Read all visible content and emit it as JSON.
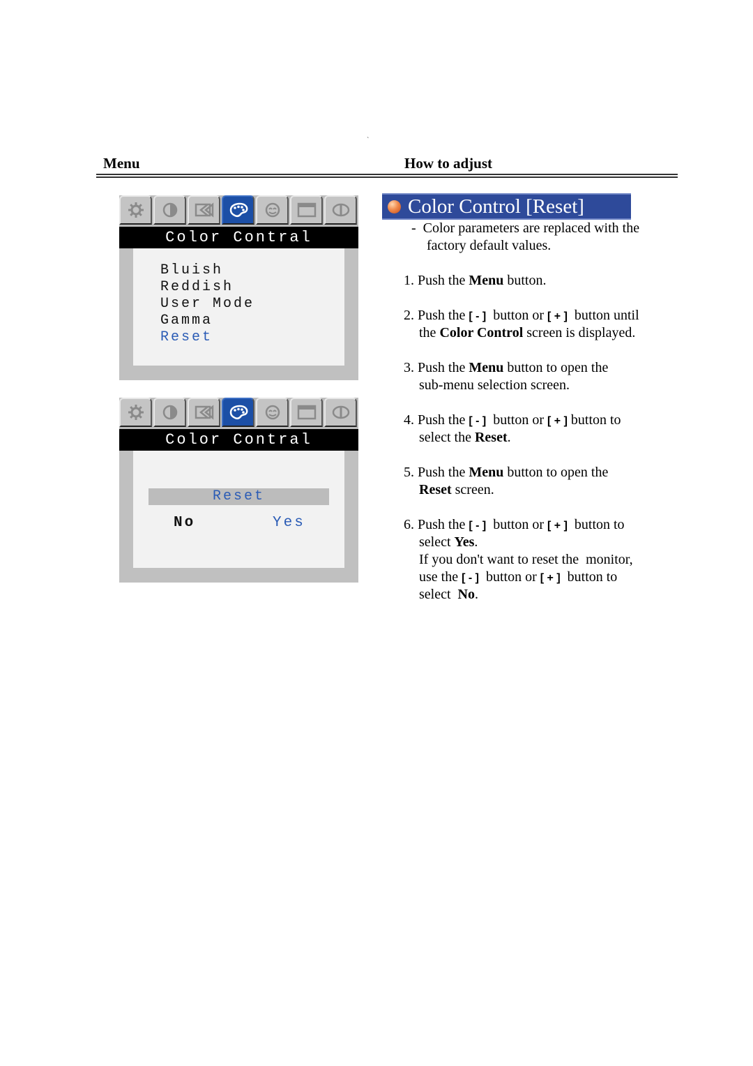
{
  "headers": {
    "menu": "Menu",
    "how_to_adjust": "How to adjust",
    "stray_mark": "`"
  },
  "osd": {
    "tabs": [
      {
        "icon": "gear-icon",
        "active": false
      },
      {
        "icon": "contrast-icon",
        "active": false
      },
      {
        "icon": "position-icon",
        "active": false
      },
      {
        "icon": "palette-icon",
        "active": true
      },
      {
        "icon": "face-icon",
        "active": false
      },
      {
        "icon": "window-icon",
        "active": false
      },
      {
        "icon": "info-icon",
        "active": false
      }
    ],
    "panel1": {
      "title": "Color Contral",
      "items": [
        "Bluish",
        "Reddish",
        "User Mode",
        "Gamma",
        "Reset"
      ],
      "selected_index": 4
    },
    "panel2": {
      "title": "Color Contral",
      "dialog_title": "Reset",
      "option_no": "No",
      "option_yes": "Yes",
      "selected_option": "Yes"
    },
    "colors": {
      "accent": "#1c4fa6",
      "highlight_text": "#2a5bb5",
      "titlebar": "#000000",
      "frame": "#c0c0c0",
      "inner": "#f2f2f2"
    }
  },
  "instructions": {
    "title": "Color Control [Reset]",
    "title_bg": "#2e4a9a",
    "intro_line1": "-  Color parameters are replaced with the",
    "intro_line2": "factory default values.",
    "minus_btn": "[ - ]",
    "plus_btn": "[ + ]",
    "steps": {
      "s1": {
        "num": "1.",
        "pre": "Push the ",
        "bold": "Menu",
        "post": " button."
      },
      "s2": {
        "num": "2.",
        "a": "Push the ",
        "b": "  button or ",
        "c": "  button until",
        "line2_pre": "the ",
        "line2_bold": "Color Control",
        "line2_post": " screen is displayed."
      },
      "s3": {
        "num": "3.",
        "pre": "Push the ",
        "bold": "Menu",
        "post": " button to open the",
        "line2": "sub-menu selection screen."
      },
      "s4": {
        "num": "4.",
        "a": "Push the ",
        "b": "  button or ",
        "c": " button to",
        "line2_pre": "select the ",
        "line2_bold": "Reset",
        "line2_post": "."
      },
      "s5": {
        "num": "5.",
        "pre": "Push the ",
        "bold": "Menu",
        "post": " button to open the",
        "line2_bold": "Reset",
        "line2_post": " screen."
      },
      "s6": {
        "num": "6.",
        "a": "Push the ",
        "b": "  button or ",
        "c": "  button to",
        "line2_pre": "select ",
        "line2_bold": "Yes",
        "line2_post": ".",
        "line3": "If you don't want to reset the  monitor,",
        "line4_a": "use the ",
        "line4_b": "  button or ",
        "line4_c": "  button to",
        "line5_pre": "select  ",
        "line5_bold": "No",
        "line5_post": "."
      }
    }
  }
}
